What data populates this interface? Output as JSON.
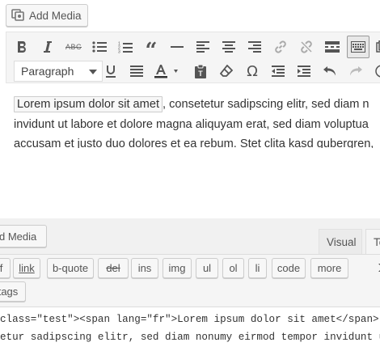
{
  "top_editor": {
    "add_media_label": "Add Media",
    "format_select": {
      "selected": "Paragraph"
    },
    "toolbar_row1": [
      "bold",
      "italic",
      "strikethrough",
      "bullet-list",
      "numbered-list",
      "blockquote",
      "horizontal-line",
      "align-left",
      "align-center",
      "align-right",
      "insert-link",
      "remove-link",
      "read-more",
      "toolbar-toggle",
      "distraction-free"
    ],
    "toolbar_row2": [
      "underline",
      "justify",
      "text-color",
      "paste-as-text",
      "clear-formatting",
      "special-character",
      "outdent",
      "indent",
      "undo",
      "redo"
    ],
    "content": {
      "highlight": "Lorem ipsum dolor sit amet",
      "line1_rest": ", consetetur sadipscing elitr, sed diam n",
      "line2": "invidunt ut labore et dolore magna aliquyam erat, sed diam voluptua",
      "line3": "accusam et justo duo dolores et ea rebum. Stet clita kasd gubergren,"
    }
  },
  "bottom_editor": {
    "add_media_label": "d Media",
    "tabs": {
      "visual": "Visual",
      "text": "Te"
    },
    "quicktags_row1": [
      "f",
      "link",
      "b-quote",
      "del",
      "ins",
      "img",
      "ul",
      "ol",
      "li",
      "code",
      "more"
    ],
    "quicktags_row2": [
      "tags"
    ],
    "code_lines": [
      "class=\"test\"><span lang=\"fr\">Lorem ipsum dolor sit amet</span>,",
      "etur sadipscing elitr, sed diam nonumy eirmod tempor invidunt ut"
    ]
  },
  "colors": {
    "toolbar_bg": "#f5f5f5",
    "border": "#dddddd",
    "text": "#333333",
    "icon": "#555555"
  }
}
